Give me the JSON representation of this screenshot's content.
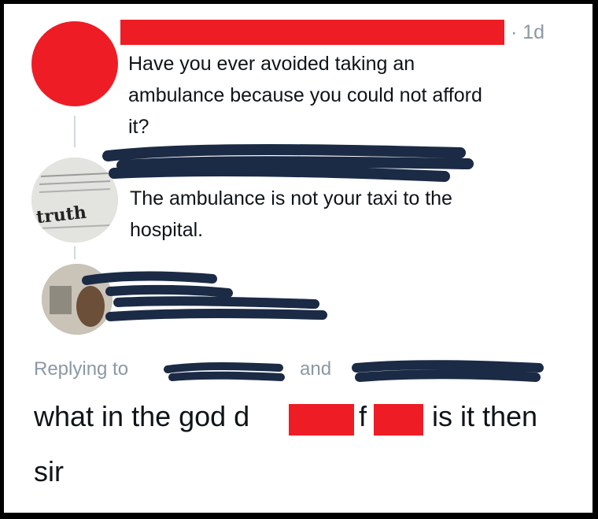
{
  "tweet1": {
    "time": "· 1d",
    "text_line1": "Have you ever avoided taking an",
    "text_line2": "ambulance because you could not afford",
    "text_line3": "it?"
  },
  "tweet2": {
    "avatar_label": "truth",
    "text_line1": "The ambulance is not your taxi to the",
    "text_line2": "hospital."
  },
  "reply": {
    "replying_to_label": "Replying to",
    "and_label": "and",
    "text_part1": "what in the god d",
    "text_part2": "f",
    "text_part3": "is it then",
    "text_line2": "sir"
  },
  "colors": {
    "redaction_red": "#ee1c25",
    "scribble_navy": "#1b2a45",
    "muted_text": "#8b98a5",
    "thread_line": "#cfd9de"
  }
}
